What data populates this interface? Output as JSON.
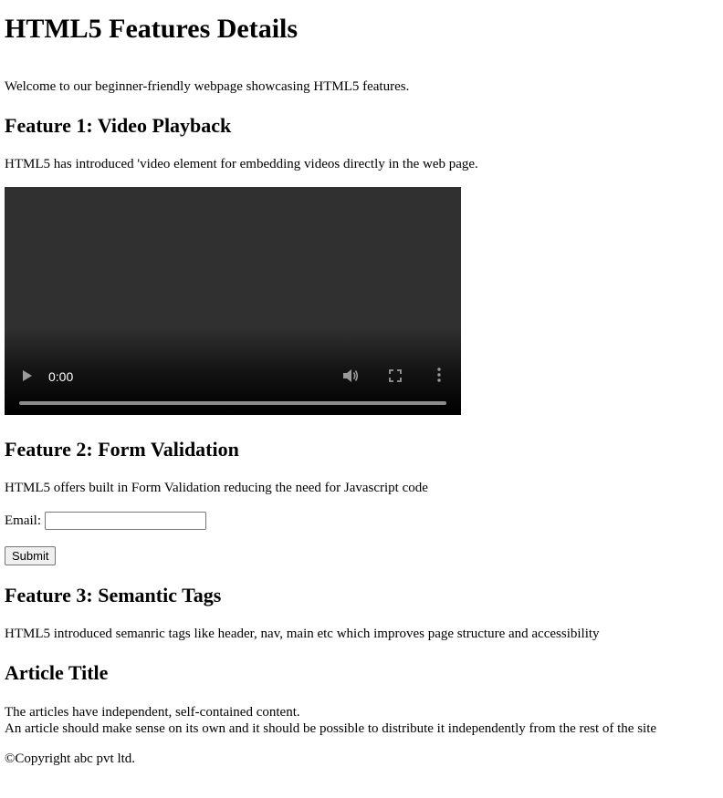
{
  "page": {
    "title": "HTML5 Features Details",
    "intro": "Welcome to our beginner-friendly webpage showcasing HTML5 features."
  },
  "feature1": {
    "heading": "Feature 1: Video Playback",
    "description": "HTML5 has introduced 'video element for embedding videos directly in the web page.",
    "video": {
      "time": "0:00",
      "icons": [
        "play-icon",
        "volume-icon",
        "fullscreen-icon",
        "more-options-icon"
      ],
      "progress": 0
    }
  },
  "feature2": {
    "heading": "Feature 2: Form Validation",
    "description": "HTML5 offers built in Form Validation reducing the need for Javascript code",
    "email_label": "Email:",
    "email_value": "",
    "submit_label": "Submit"
  },
  "feature3": {
    "heading": "Feature 3: Semantic Tags",
    "description": "HTML5 introduced semanric tags like header, nav, main etc which improves page structure and accessibility"
  },
  "article": {
    "title": "Article Title",
    "line1": "The articles have independent, self-contained content.",
    "line2": "An article should make sense on its own and it should be possible to distribute it independently from the rest of the site"
  },
  "footer": {
    "copyright": "©Copyright abc pvt ltd."
  },
  "colors": {
    "video_background": "#303030",
    "video_controls_fade": "#000000",
    "text": "#000000",
    "button_background": "#efefef"
  }
}
